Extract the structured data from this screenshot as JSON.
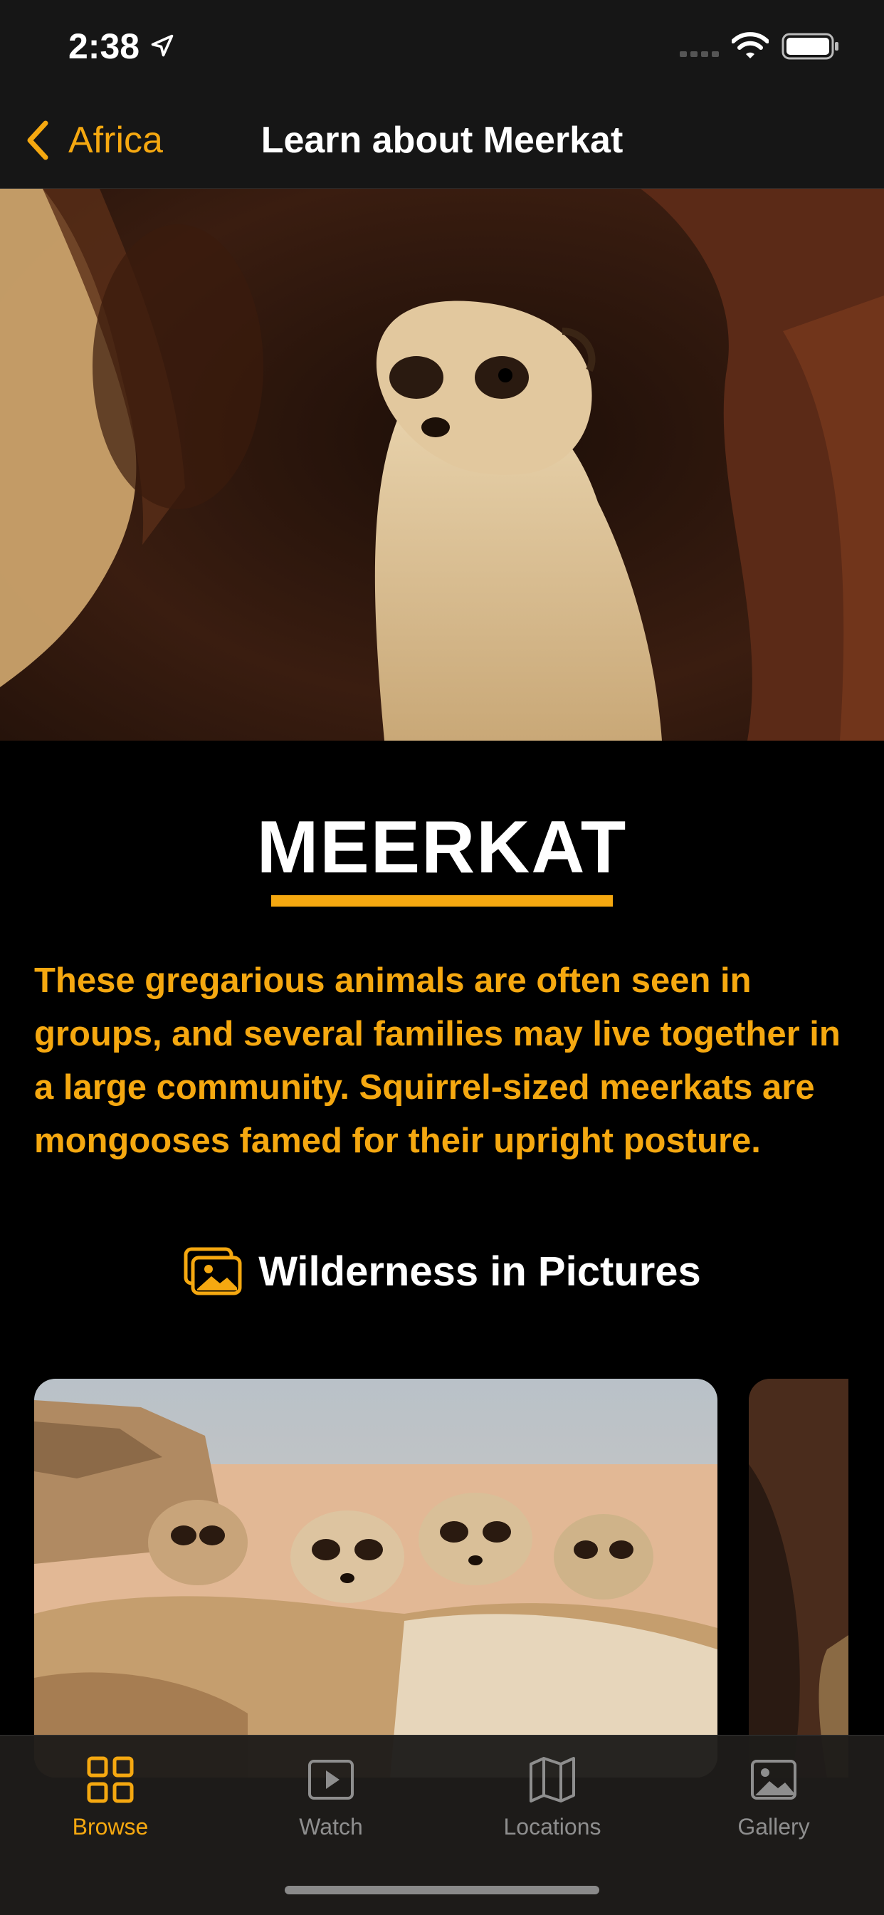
{
  "status_bar": {
    "time": "2:38"
  },
  "nav": {
    "back_label": "Africa",
    "title": "Learn about Meerkat"
  },
  "animal": {
    "name": "MEERKAT",
    "description": "These gregarious animals are often seen in groups, and several families may live together in a large community. Squirrel-sized meerkats are mongooses famed for their upright posture."
  },
  "gallery_section": {
    "icon": "photos-icon",
    "title": "Wilderness in Pictures"
  },
  "tabs": [
    {
      "label": "Browse",
      "icon": "grid-icon",
      "active": true
    },
    {
      "label": "Watch",
      "icon": "play-icon",
      "active": false
    },
    {
      "label": "Locations",
      "icon": "map-icon",
      "active": false
    },
    {
      "label": "Gallery",
      "icon": "photo-icon",
      "active": false
    }
  ],
  "colors": {
    "accent": "#f5a810",
    "background": "#000000",
    "bar": "#161616"
  }
}
